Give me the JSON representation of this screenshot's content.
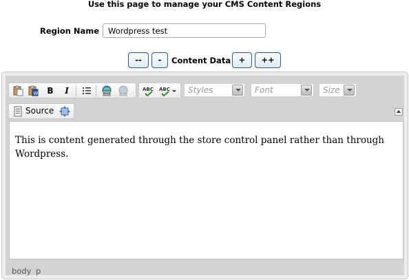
{
  "page": {
    "title": "Use this page to manage your CMS Content Regions"
  },
  "region": {
    "label": "Region Name",
    "value": "Wordpress test"
  },
  "content_controls": {
    "label": "Content Data",
    "decrease_more": "--",
    "decrease": "-",
    "increase": "+",
    "increase_more": "++"
  },
  "editor": {
    "combos": {
      "styles": "Styles",
      "font": "Font",
      "size": "Size"
    },
    "source_label": "Source",
    "content": "This is content generated through the store control panel rather than through Wordpress.",
    "path": [
      "body",
      "p"
    ],
    "icons": [
      "paste-icon",
      "paste-from-word-icon",
      "bold-icon",
      "italic-icon",
      "bulleted-list-icon",
      "link-icon",
      "unlink-icon",
      "spellcheck-icon",
      "spellcheck-as-you-type-icon",
      "source-icon",
      "maximize-icon",
      "collapse-toolbar-icon"
    ]
  }
}
